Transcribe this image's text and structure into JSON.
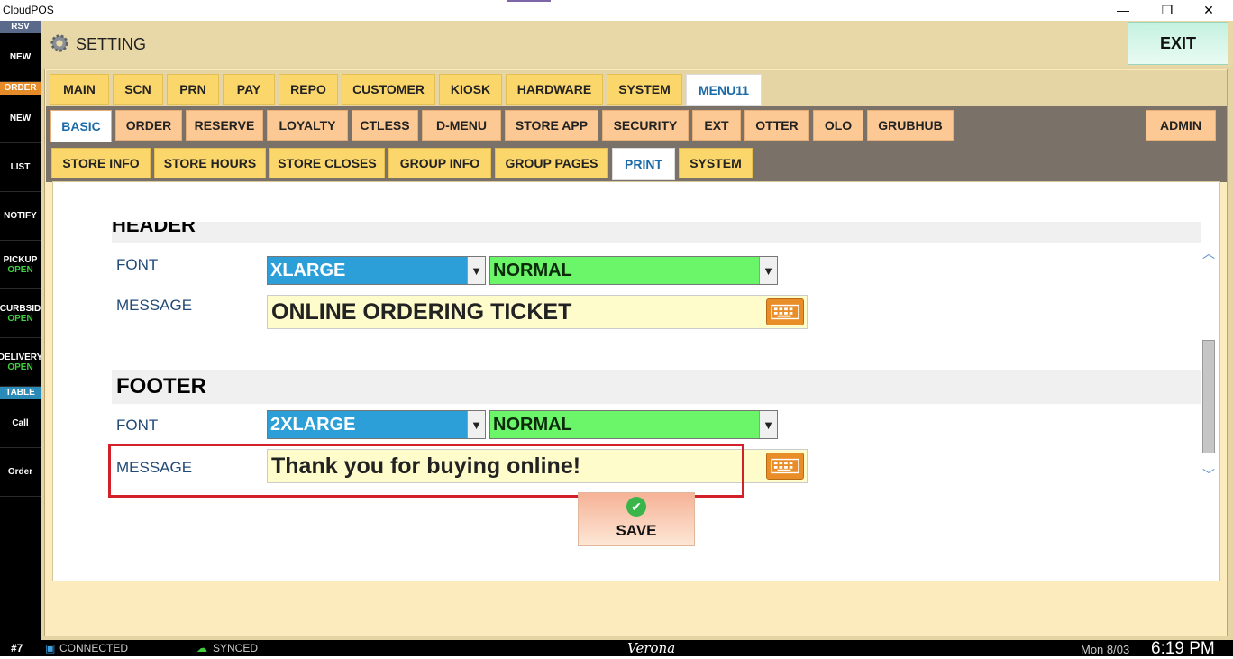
{
  "window": {
    "title": "CloudPOS",
    "minimize": "—",
    "maximize": "❐",
    "close": "✕"
  },
  "sidebar": {
    "rsv_header": "RSV",
    "rsv_new": "NEW",
    "order_header": "ORDER",
    "items": [
      {
        "label": "NEW",
        "sub": ""
      },
      {
        "label": "LIST",
        "sub": ""
      },
      {
        "label": "NOTIFY",
        "sub": ""
      },
      {
        "label": "PICKUP",
        "sub": "OPEN"
      },
      {
        "label": "CURBSID",
        "sub": "OPEN"
      },
      {
        "label": "DELIVERY",
        "sub": "OPEN"
      }
    ],
    "table_header": "TABLE",
    "table_items": [
      "Call",
      "Order"
    ]
  },
  "header": {
    "title": "SETTING",
    "exit_label": "EXIT"
  },
  "tabs_main": [
    "MAIN",
    "SCN",
    "PRN",
    "PAY",
    "REPO",
    "CUSTOMER",
    "KIOSK",
    "HARDWARE",
    "SYSTEM",
    "MENU11"
  ],
  "tabs_main_active": "MENU11",
  "tabs_second": [
    "BASIC",
    "ORDER",
    "RESERVE",
    "LOYALTY",
    "CTLESS",
    "D-MENU",
    "STORE APP",
    "SECURITY",
    "EXT",
    "OTTER",
    "OLO",
    "GRUBHUB",
    "ADMIN"
  ],
  "tabs_second_active": "BASIC",
  "tabs_third": [
    "STORE INFO",
    "STORE HOURS",
    "STORE CLOSES",
    "GROUP INFO",
    "GROUP PAGES",
    "PRINT",
    "SYSTEM"
  ],
  "tabs_third_active": "PRINT",
  "header_section": {
    "title": "HEADER",
    "font_label": "FONT",
    "font_size": "XLARGE",
    "font_style": "NORMAL",
    "message_label": "MESSAGE",
    "message_value": "ONLINE ORDERING TICKET"
  },
  "footer_section": {
    "title": "FOOTER",
    "font_label": "FONT",
    "font_size": "2XLARGE",
    "font_style": "NORMAL",
    "message_label": "MESSAGE",
    "message_value": "Thank you for buying online!"
  },
  "save_label": "SAVE",
  "status": {
    "terminal": "#7",
    "connection": "CONNECTED",
    "sync": "SYNCED",
    "store": "Verona",
    "date": "Mon 8/03",
    "time": "6:19 PM"
  },
  "colors": {
    "accent_blue": "#2d9fd8",
    "accent_green": "#6bf569",
    "highlight_red": "#d42029",
    "tab_yellow": "#fbd66b",
    "tab_orange": "#fcc894"
  }
}
